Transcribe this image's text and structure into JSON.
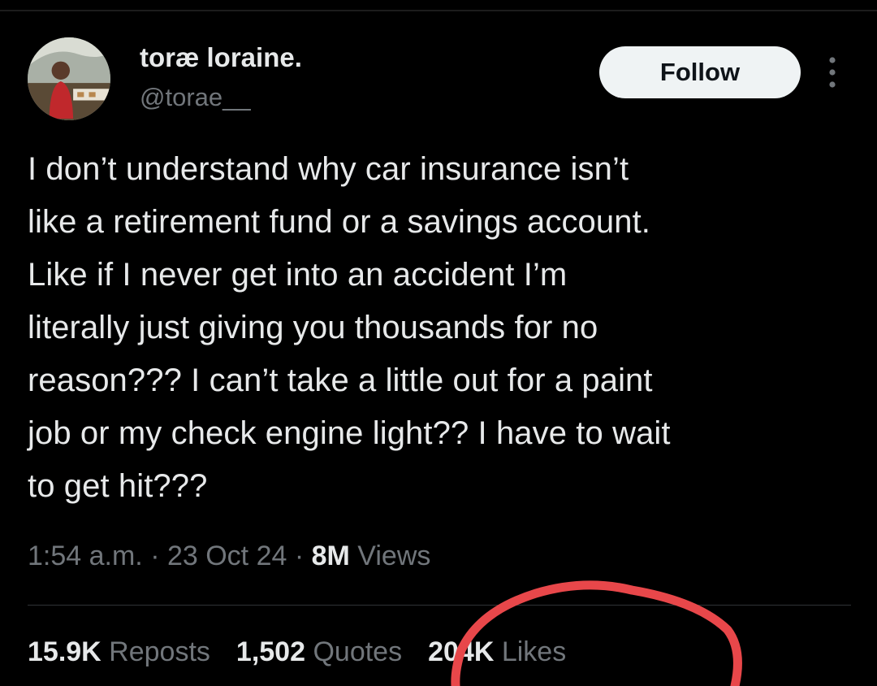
{
  "author": {
    "display_name": "toræ loraine.",
    "handle": "@torae__"
  },
  "follow_label": "Follow",
  "tweet": {
    "text": "I don’t understand why car insurance isn’t\nlike a retirement fund or a savings account.\nLike if I never get into an accident I’m\nliterally just giving you thousands for no\nreason??? I can’t take a little out for a paint\njob or my check engine light?? I have to wait\nto get hit???"
  },
  "meta": {
    "time": "1:54 a.m.",
    "sep1": " · ",
    "date": "23 Oct 24",
    "sep2": " · ",
    "views_count": "8M",
    "views_label": " Views"
  },
  "stats": {
    "reposts_count": "15.9K",
    "reposts_label": " Reposts",
    "quotes_count": "1,502",
    "quotes_label": " Quotes",
    "likes_count": "204K",
    "likes_label": " Likes"
  },
  "annotation": {
    "color": "#e8474a"
  },
  "icons": {
    "more": "more-vertical-icon"
  }
}
